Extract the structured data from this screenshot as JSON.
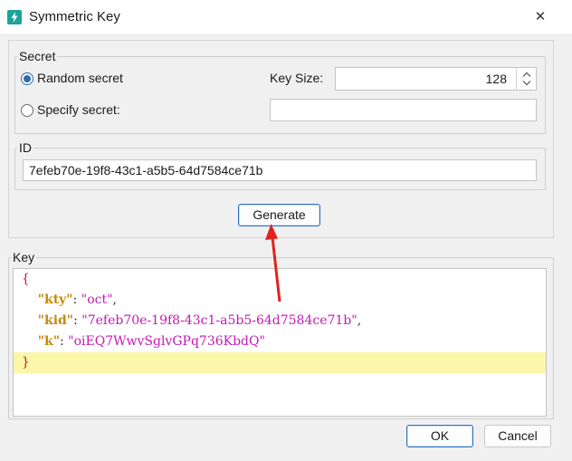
{
  "window": {
    "title": "Symmetric Key",
    "app_icon": "lightning-bolt-icon",
    "close_icon": "close-icon"
  },
  "secret": {
    "group_label": "Secret",
    "random_label": "Random secret",
    "specify_label": "Specify secret:",
    "selected": "random",
    "key_size_label": "Key Size:",
    "key_size_value": "128",
    "specify_value": ""
  },
  "id_group": {
    "label": "ID",
    "value": "7efeb70e-19f8-43c1-a5b5-64d7584ce71b"
  },
  "generate_label": "Generate",
  "key_group": {
    "label": "Key",
    "open_brace": "{",
    "close_brace": "}",
    "entries": [
      {
        "key": "\"kty\"",
        "value": "\"oct\"",
        "sep": ": ",
        "tail": ","
      },
      {
        "key": "\"kid\"",
        "value": "\"7efeb70e-19f8-43c1-a5b5-64d7584ce71b\"",
        "sep": ": ",
        "tail": ","
      },
      {
        "key": "\"k\"",
        "value": "\"oiEQ7WwvSglvGPq736KbdQ\"",
        "sep": ": ",
        "tail": ""
      }
    ]
  },
  "footer": {
    "ok_label": "OK",
    "cancel_label": "Cancel"
  },
  "colors": {
    "accent": "#2b6cb3",
    "json_brace": "#c2173a",
    "json_key": "#c58a0f",
    "json_string": "#c21ab2",
    "highlight_line": "#fbf7a9",
    "annotation_arrow": "#e0221f"
  }
}
